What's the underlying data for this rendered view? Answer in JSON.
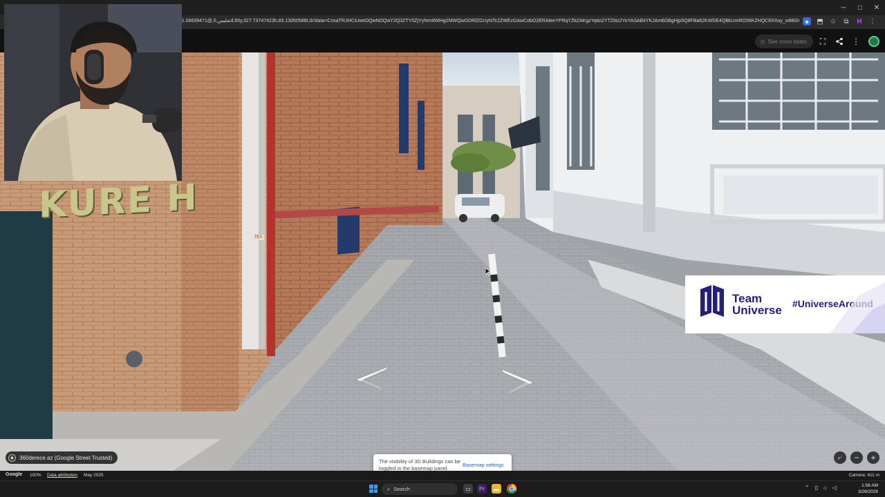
{
  "browser": {
    "url": "111.06639471@,تفليس,0d,60y,327.73747423h,83.13050588t,0r/data=CnsaTRJHCiUweDQwNDQwY2Q3ZTY0ZjYyNmI6MHg2MWQwODRlZGUyNTc2ZWEzGAwCobO2ERAleeYPRqYZkZAKgzYqtio2YTZitiz2YoYASABIiYKJAm6DBgHjp5Q8FBa62KWDE4QBkUmRO56KZHQCEK0uy_w8BGQEICEAIi..."
  },
  "window_controls": {
    "minimize": "─",
    "maximize": "□",
    "close": "✕"
  },
  "maps_header": {
    "see_more_label": "See more dates"
  },
  "scene": {
    "sign_text": "KURE H",
    "wall_sign": "ΤΕΛ"
  },
  "banner": {
    "name": "Team Universe",
    "hashtag": "#UniverseAround"
  },
  "attribution_chip": {
    "label": "360derece az (Google Street Trusted)"
  },
  "toast": {
    "message": "The visibility of 3D Buildings can be toggled in the basemap panel.",
    "action_label": "Basemap settings"
  },
  "footer": {
    "brand": "Google",
    "zoom": "100%",
    "data_attribution": "Data attribution",
    "date": "May 2025",
    "camera": "Camera: 411 m"
  },
  "taskbar": {
    "search_placeholder": "Search",
    "time": "1:56 AM",
    "date": "3/28/2026"
  },
  "colors": {
    "banner_text": "#231f7a",
    "link_blue": "#1a63d6",
    "windows_blue": "#3b9cf6"
  }
}
